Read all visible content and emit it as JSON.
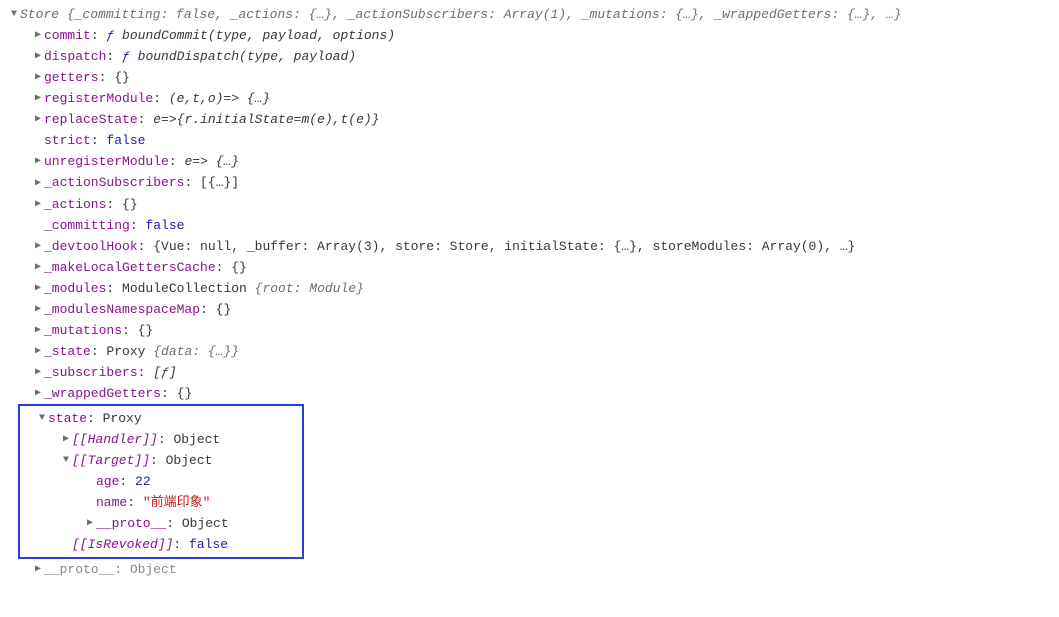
{
  "arrows": {
    "right": "▶",
    "down": "▼"
  },
  "root": {
    "name": "Store",
    "preview": "{_committing: false, _actions: {…}, _actionSubscribers: Array(1), _mutations: {…}, _wrappedGetters: {…}, …}"
  },
  "lines": [
    {
      "arrow": "right",
      "key": "commit",
      "keyColor": "purple",
      "fvalue": "ƒ",
      "sig": " boundCommit(type, payload, options)"
    },
    {
      "arrow": "right",
      "key": "dispatch",
      "keyColor": "purple",
      "fvalue": "ƒ",
      "sig": " boundDispatch(type, payload)"
    },
    {
      "arrow": "right",
      "key": "getters",
      "keyColor": "purple",
      "val": "{}",
      "valColor": "default"
    },
    {
      "arrow": "right",
      "key": "registerModule",
      "keyColor": "purple",
      "sig": "(e,t,o)=> {…}"
    },
    {
      "arrow": "right",
      "key": "replaceState",
      "keyColor": "purple",
      "sig": "e=>{r.initialState=m(e),t(e)}"
    },
    {
      "arrow": "none",
      "key": "strict",
      "keyColor": "purple",
      "val": "false",
      "valColor": "blue"
    },
    {
      "arrow": "right",
      "key": "unregisterModule",
      "keyColor": "purple",
      "sig": "e=> {…}"
    },
    {
      "arrow": "right",
      "key": "_actionSubscribers",
      "keyColor": "purple",
      "val": "[{…}]",
      "valColor": "default"
    },
    {
      "arrow": "right",
      "key": "_actions",
      "keyColor": "purple",
      "val": "{}",
      "valColor": "default"
    },
    {
      "arrow": "none",
      "key": "_committing",
      "keyColor": "purple",
      "val": "false",
      "valColor": "blue"
    },
    {
      "arrow": "right",
      "key": "_devtoolHook",
      "keyColor": "purple",
      "val": "{Vue: null, _buffer: Array(3), store: Store, initialState: {…}, storeModules: Array(0), …}",
      "valColor": "default"
    },
    {
      "arrow": "right",
      "key": "_makeLocalGettersCache",
      "keyColor": "purple",
      "val": "{}",
      "valColor": "default"
    },
    {
      "arrow": "right",
      "key": "_modules",
      "keyColor": "purple",
      "val": "ModuleCollection ",
      "valColor": "default",
      "preview": "{root: Module}"
    },
    {
      "arrow": "right",
      "key": "_modulesNamespaceMap",
      "keyColor": "purple",
      "val": "{}",
      "valColor": "default"
    },
    {
      "arrow": "right",
      "key": "_mutations",
      "keyColor": "purple",
      "val": "{}",
      "valColor": "default"
    },
    {
      "arrow": "right",
      "key": "_state",
      "keyColor": "purple",
      "val": "Proxy ",
      "valColor": "default",
      "preview": "{data: {…}}"
    },
    {
      "arrow": "right",
      "key": "_subscribers",
      "keyColor": "purple",
      "sig": "[ƒ]"
    },
    {
      "arrow": "right",
      "key": "_wrappedGetters",
      "keyColor": "purple",
      "val": "{}",
      "valColor": "default"
    }
  ],
  "state": {
    "key": "state",
    "type": "Proxy",
    "handler": {
      "key": "[[Handler]]",
      "val": "Object"
    },
    "target": {
      "key": "[[Target]]",
      "val": "Object",
      "age": {
        "key": "age",
        "val": "22"
      },
      "name": {
        "key": "name",
        "val": "\"前端印象\""
      },
      "proto": {
        "key": "__proto__",
        "val": "Object"
      }
    },
    "isRevoked": {
      "key": "[[IsRevoked]]",
      "val": "false"
    }
  },
  "protoEnd": {
    "key": "__proto__",
    "val": "Object"
  }
}
